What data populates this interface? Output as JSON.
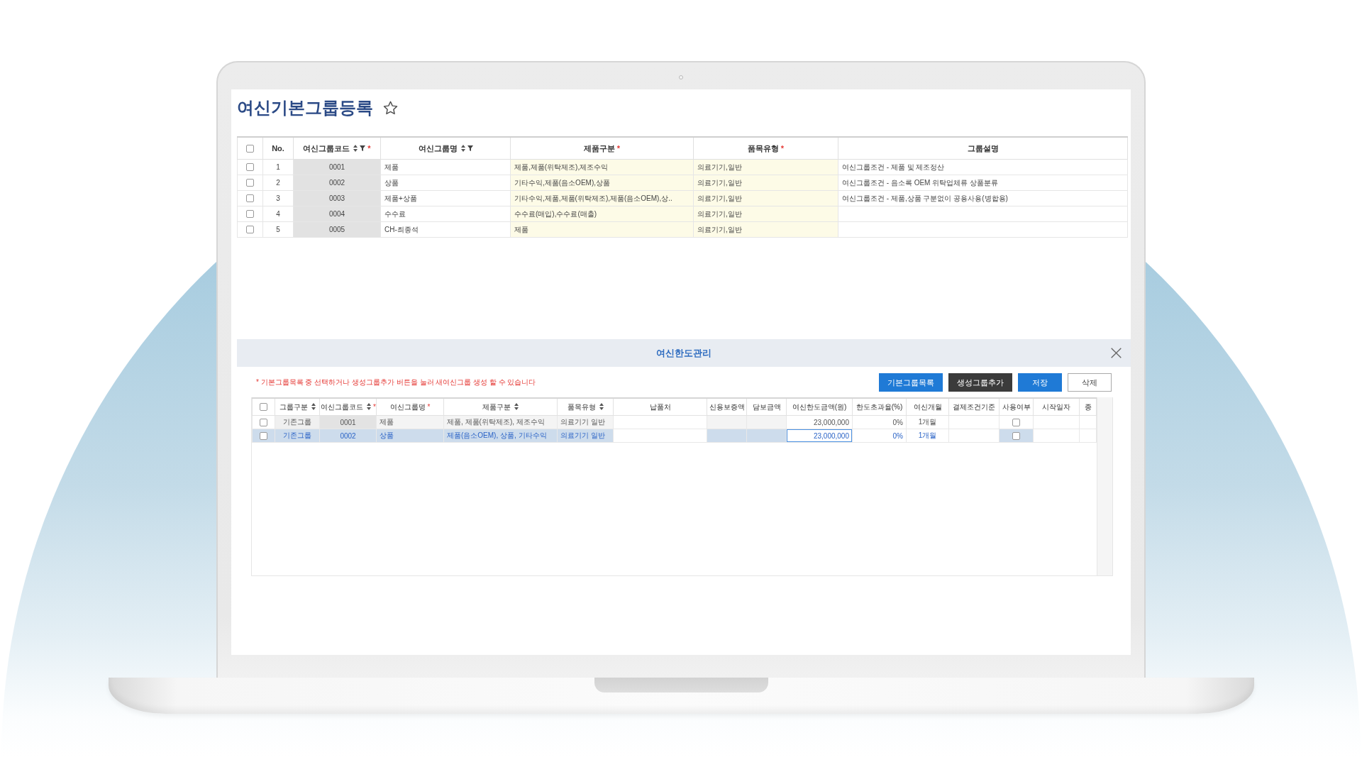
{
  "page": {
    "title": "여신기본그룹등록",
    "favorite": false
  },
  "group_table": {
    "all_checked": false,
    "columns": [
      {
        "label": "No.",
        "kind": "number",
        "sort": false,
        "filter": false
      },
      {
        "label": "여신그룹코드",
        "kind": "key",
        "sort": true,
        "filter": true,
        "mark": "*"
      },
      {
        "label": "여신그룹명",
        "kind": "text",
        "sort": true,
        "filter": true
      },
      {
        "label": "제품구분",
        "kind": "required",
        "sort": false,
        "filter": false,
        "mark": "*"
      },
      {
        "label": "품목유형",
        "kind": "required",
        "sort": false,
        "filter": false,
        "mark": "*"
      },
      {
        "label": "그룹설명",
        "kind": "text",
        "sort": false,
        "filter": false
      }
    ],
    "rows": [
      {
        "checked": false,
        "selected": false,
        "cells": [
          "1",
          "0001",
          "제품",
          "제품,제품(위탁제조),제조수익",
          "의료기기,일반",
          "여신그룹조건 - 제품 및 제조정산"
        ]
      },
      {
        "checked": false,
        "selected": false,
        "cells": [
          "2",
          "0002",
          "상품",
          "기타수익,제품(음소OEM),상품",
          "의료기기,일반",
          "여신그룹조건 - 음소록 OEM 위탁업체류 상품분류"
        ]
      },
      {
        "checked": false,
        "selected": false,
        "cells": [
          "3",
          "0003",
          "제품+상품",
          "기타수익,제품,제품(위탁제조),제품(음소OEM),상..",
          "의료기기,일반",
          "여신그룹조건 - 제품,상품 구분없이 공용사용(병합용)"
        ]
      },
      {
        "checked": false,
        "selected": false,
        "cells": [
          "4",
          "0004",
          "수수료",
          "수수료(매입),수수료(매출)",
          "의료기기,일반"
        ]
      },
      {
        "checked": false,
        "selected": false,
        "cells": [
          "5",
          "0005",
          "CH-최종석",
          "제품",
          "의료기기,일반"
        ]
      }
    ]
  },
  "limit_panel": {
    "title": "여신한도관리",
    "notice": "* 기본그룹목록 중 선택하거나 생성그룹추가 버튼을 눌러 새여신그룹 생성 할 수 있습니다",
    "buttons": [
      {
        "label": "기본그룹목록",
        "kind": "primary"
      },
      {
        "label": "생성그룹추가",
        "kind": "dark"
      },
      {
        "label": "저장",
        "kind": "primary"
      },
      {
        "label": "삭제",
        "kind": "outline"
      }
    ],
    "table": {
      "all_checked": false,
      "columns": [
        {
          "label": "그룹구분",
          "kind": "tag",
          "sort": true
        },
        {
          "label": "여신그룹코드",
          "kind": "key",
          "sort": true,
          "mark": "*"
        },
        {
          "label": "여신그룹명",
          "kind": "locked",
          "sort": false,
          "mark": "*"
        },
        {
          "label": "제품구분",
          "kind": "locked",
          "sort": true
        },
        {
          "label": "품목유형",
          "kind": "locked",
          "sort": true
        },
        {
          "label": "납품처",
          "kind": "text",
          "sort": false
        },
        {
          "label": "신용보증액",
          "kind": "locked",
          "sort": false
        },
        {
          "label": "담보금액",
          "kind": "locked",
          "sort": false
        },
        {
          "label": "여신한도금액(원)",
          "kind": "amount",
          "sort": false
        },
        {
          "label": "한도초과율(%)",
          "kind": "number",
          "sort": false
        },
        {
          "label": "여신개월",
          "kind": "month",
          "sort": false
        },
        {
          "label": "결제조건기준",
          "kind": "text",
          "sort": false
        },
        {
          "label": "사용여부",
          "kind": "check",
          "sort": false
        },
        {
          "label": "시작일자",
          "kind": "text",
          "sort": false
        },
        {
          "label": "종",
          "kind": "text",
          "sort": false
        }
      ],
      "rows": [
        {
          "checked": false,
          "selected": false,
          "editing": false,
          "in_use": false,
          "cells": [
            "기존그룹",
            "0001",
            "제품",
            "제품, 제품(위탁제조), 제조수익",
            "의료기기 일반",
            null,
            null,
            null,
            "23,000,000",
            "0%",
            "1개월"
          ]
        },
        {
          "checked": false,
          "selected": true,
          "editing": true,
          "in_use": false,
          "cells": [
            "기존그룹",
            "0002",
            "상품",
            "제품(음소OEM), 상품, 기타수익",
            "의료기기 일반",
            null,
            null,
            null,
            "23,000,000",
            "0%",
            "1개월"
          ]
        }
      ]
    }
  }
}
